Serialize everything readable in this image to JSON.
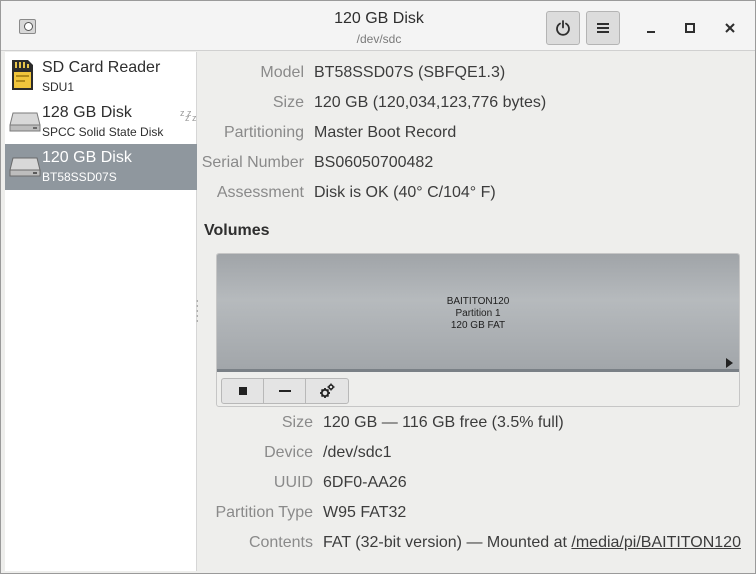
{
  "header": {
    "title": "120 GB Disk",
    "subtitle": "/dev/sdc",
    "buttons": [
      "power-icon",
      "hamburger-menu-icon"
    ],
    "window_controls": [
      "minimize",
      "maximize",
      "close"
    ]
  },
  "sidebar": {
    "drives": [
      {
        "name": "SD Card Reader",
        "sub": "SDU1",
        "icon": "sd-card-icon"
      },
      {
        "name": "128 GB Disk",
        "sub": "SPCC Solid State Disk",
        "icon": "disk-drive-icon",
        "badge": "zzz"
      },
      {
        "name": "120 GB Disk",
        "sub": "BT58SSD07S",
        "icon": "disk-drive-icon",
        "selected": true
      }
    ]
  },
  "drive_info": {
    "model_label": "Model",
    "model": "BT58SSD07S (SBFQE1.3)",
    "size_label": "Size",
    "size": "120 GB (120,034,123,776 bytes)",
    "partitioning_label": "Partitioning",
    "partitioning": "Master Boot Record",
    "serial_label": "Serial Number",
    "serial": "BS06050700482",
    "assessment_label": "Assessment",
    "assessment": "Disk is OK (40° C/104° F)"
  },
  "volumes": {
    "title": "Volumes",
    "partition": {
      "name": "BAITITON120",
      "number": "Partition 1",
      "desc": "120 GB FAT"
    },
    "toolbar": [
      "stop-icon",
      "minus-icon",
      "gears-icon"
    ]
  },
  "volume_info": {
    "size_label": "Size",
    "size": "120 GB — 116 GB free (3.5% full)",
    "device_label": "Device",
    "device": "/dev/sdc1",
    "uuid_label": "UUID",
    "uuid": "6DF0-AA26",
    "type_label": "Partition Type",
    "type": "W95 FAT32",
    "contents_label": "Contents",
    "contents": "FAT (32-bit version) — Mounted at ",
    "mount_link": "/media/pi/BAITITON120"
  },
  "colors": {
    "selection": "#8f979e",
    "partition": "#a8acb0",
    "window_bg": "#eeeeec"
  }
}
